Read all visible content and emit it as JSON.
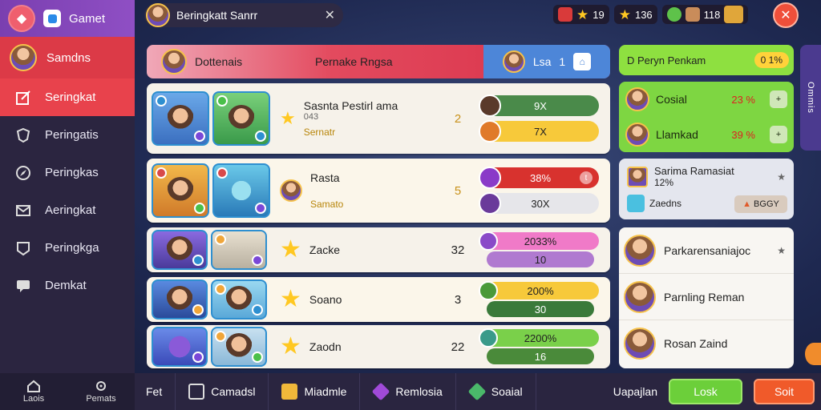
{
  "sidebar": {
    "app_title": "Gamet",
    "user_name": "Samdns",
    "items": [
      {
        "label": "Seringkat"
      },
      {
        "label": "Peringatis"
      },
      {
        "label": "Peringkas"
      },
      {
        "label": "Aeringkat"
      },
      {
        "label": "Peringkga"
      },
      {
        "label": "Demkat"
      }
    ],
    "bottom": [
      {
        "label": "Laois"
      },
      {
        "label": "Pemats"
      }
    ]
  },
  "topbar": {
    "search_text": "Beringkatt Sanrr",
    "stats": [
      {
        "value": "19",
        "icon": "star-icon"
      },
      {
        "value": "136",
        "icon": "star-icon"
      },
      {
        "value": "118",
        "icon": "chest-icon"
      }
    ]
  },
  "table_header": {
    "left": "Dottenais",
    "center": "Pernake Rngsa",
    "right_label": "Lsa",
    "right_value": "1"
  },
  "rows": [
    {
      "name": "Sasnta Pestirl ama",
      "sub": "043",
      "badge": "Sernatr",
      "rank": "2",
      "bar1": "9X",
      "bar2": "7X"
    },
    {
      "name": "Rasta",
      "sub": "",
      "badge": "Samato",
      "rank": "5",
      "bar1": "38%",
      "bar2": "30X"
    },
    {
      "name": "Zacke",
      "sub": "",
      "badge": "",
      "rank": "32",
      "bar1": "2033%",
      "bar2": "10"
    },
    {
      "name": "Soano",
      "sub": "",
      "badge": "",
      "rank": "3",
      "bar1": "200%",
      "bar2": "30"
    },
    {
      "name": "Zaodn",
      "sub": "",
      "badge": "",
      "rank": "22",
      "bar1": "2200%",
      "bar2": "16"
    }
  ],
  "right_panel": {
    "header": "D Peryn Penkam",
    "header_pct": "0 1%",
    "green_items": [
      {
        "name": "Cosial",
        "value": "23 %"
      },
      {
        "name": "Llamkad",
        "value": "39 %"
      }
    ],
    "mid_title": "Sarima Ramasiat",
    "mid_sub": "12%",
    "mid_name": "Zaedns",
    "mid_button": "BGGY",
    "list": [
      {
        "name": "Parkarensaniajoc"
      },
      {
        "name": "Parnling Reman"
      },
      {
        "name": "Rosan Zaind"
      }
    ],
    "side_tab": "Ommis"
  },
  "bottom_bar": {
    "tabs": [
      {
        "label": "Fet"
      },
      {
        "label": "Camadsl"
      },
      {
        "label": "Miadmle"
      },
      {
        "label": "Remlosia"
      },
      {
        "label": "Soaial"
      }
    ],
    "right_text": "Uapajlan",
    "green_button": "Losk",
    "orange_button": "Soit"
  },
  "colors": {
    "sidebar_active": "#e8424c",
    "accent_green": "#7ed642",
    "accent_blue": "#4d86d8",
    "close_red": "#ef4f3a"
  }
}
